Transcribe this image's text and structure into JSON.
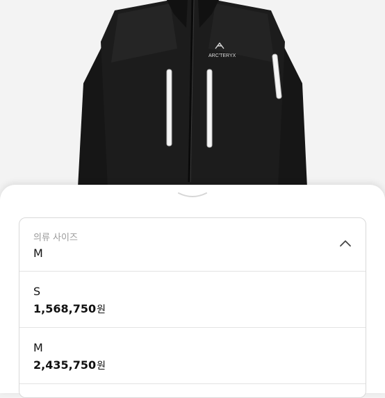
{
  "product_image": {
    "brand_logo_text": "ARC'TERYX",
    "icon": "jacket-photo"
  },
  "size_select": {
    "label": "의류 사이즈",
    "selected_value": "M",
    "icon": "chevron-up-icon"
  },
  "options": [
    {
      "name": "S",
      "price": "1,568,750",
      "currency": "원"
    },
    {
      "name": "M",
      "price": "2,435,750",
      "currency": "원"
    }
  ],
  "colors": {
    "jacket": "#1b1b1b",
    "zip_vent": "#f5f5f5",
    "sheet_bg": "#ffffff",
    "border": "#d9d9d9"
  }
}
